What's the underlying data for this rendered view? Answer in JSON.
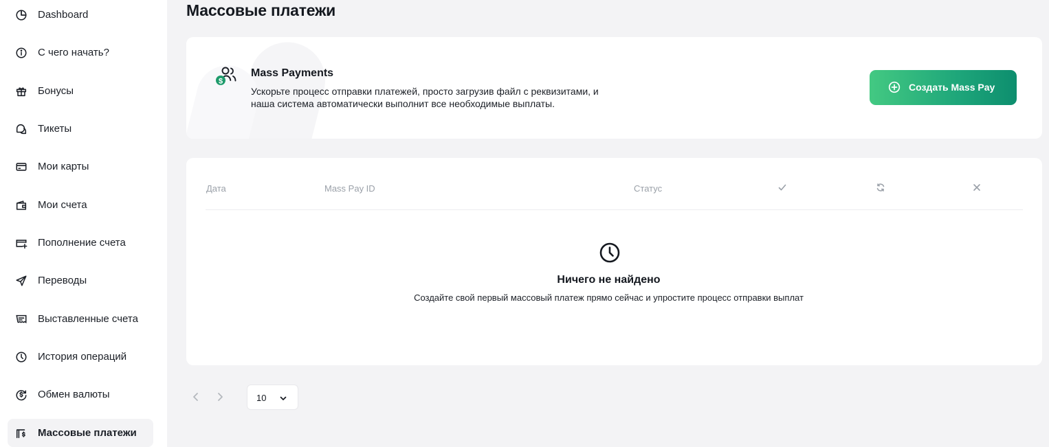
{
  "sidebar": {
    "items": [
      {
        "label": "Dashboard",
        "icon": "pie-chart-icon"
      },
      {
        "label": "С чего начать?",
        "icon": "info-icon"
      },
      {
        "label": "Бонусы",
        "icon": "gift-icon"
      },
      {
        "label": "Тикеты",
        "icon": "chat-bubbles-icon"
      },
      {
        "label": "Мои карты",
        "icon": "credit-card-icon"
      },
      {
        "label": "Мои счета",
        "icon": "wallet-icon"
      },
      {
        "label": "Пополнение счета",
        "icon": "card-plus-icon"
      },
      {
        "label": "Переводы",
        "icon": "send-icon"
      },
      {
        "label": "Выставленные счета",
        "icon": "invoice-icon"
      },
      {
        "label": "История операций",
        "icon": "clock-icon"
      },
      {
        "label": "Обмен валюты",
        "icon": "exchange-icon"
      },
      {
        "label": "Массовые платежи",
        "icon": "mass-payments-icon",
        "active": true
      }
    ]
  },
  "page": {
    "title": "Массовые платежи"
  },
  "promo": {
    "icon": "users-dollar-icon",
    "title": "Mass Payments",
    "description": "Ускорьте процесс отправки платежей, просто загрузив файл с реквизитами, и наша система автоматически выполнит все необходимые выплаты.",
    "button_label": "Создать Mass Pay",
    "button_icon": "plus-circle-icon"
  },
  "table": {
    "columns": {
      "date": "Дата",
      "id": "Mass Pay ID",
      "status": "Статус",
      "success_icon": "check-icon",
      "pending_icon": "refresh-icon",
      "failed_icon": "x-icon"
    },
    "rows": [],
    "empty": {
      "icon": "clock-icon",
      "title": "Ничего не найдено",
      "description": "Создайте свой первый массовый платеж прямо сейчас и упростите процесс отправки выплат"
    }
  },
  "pagination": {
    "per_page": "10"
  },
  "colors": {
    "accent_start": "#43c982",
    "accent_end": "#0d8e6e",
    "background": "#f3f3f5"
  }
}
